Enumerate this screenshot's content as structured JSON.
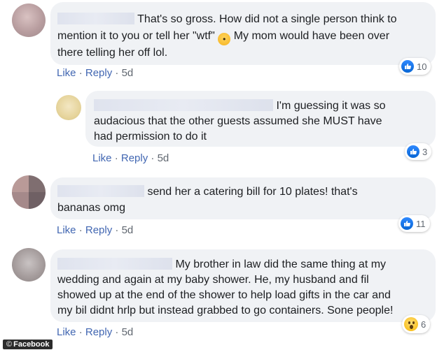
{
  "comments": [
    {
      "text_lines": [
        "That's so gross. How did not a single person think to",
        "mention it to you or tell her \"wtf\"",
        "My mom would have been over",
        "there telling her off lol."
      ],
      "like_label": "Like",
      "reply_label": "Reply",
      "separator": "·",
      "time": "5d",
      "reaction_count": "10",
      "reaction_icon": "like-icon"
    },
    {
      "text_lines": [
        "I'm guessing it was so",
        "audacious that the other guests assumed she MUST have",
        "had permission to do it"
      ],
      "like_label": "Like",
      "reply_label": "Reply",
      "separator": "·",
      "time": "5d",
      "reaction_count": "3",
      "reaction_icon": "like-icon"
    },
    {
      "text_lines": [
        "send her a catering bill for 10 plates! that's",
        "bananas omg"
      ],
      "like_label": "Like",
      "reply_label": "Reply",
      "separator": "·",
      "time": "5d",
      "reaction_count": "11",
      "reaction_icon": "like-icon"
    },
    {
      "text_lines": [
        "My brother in law did the same thing at my",
        "wedding and again at my baby shower. He, my husband and fil",
        "showed up at the end of the shower to help load gifts in the car and",
        "my bil didnt hrlp but instead grabbed to go containers. Sone people!"
      ],
      "like_label": "Like",
      "reply_label": "Reply",
      "separator": "·",
      "time": "5d",
      "reaction_count": "6",
      "reaction_icon": "wow-icon"
    }
  ],
  "colors": {
    "bubble": "#f0f2f5",
    "link": "#4267b2",
    "meta_gray": "#606770",
    "like_blue": "#0866d4",
    "wow_yellow": "#f7b500"
  },
  "watermark": {
    "symbol": "©",
    "label": "Facebook"
  }
}
